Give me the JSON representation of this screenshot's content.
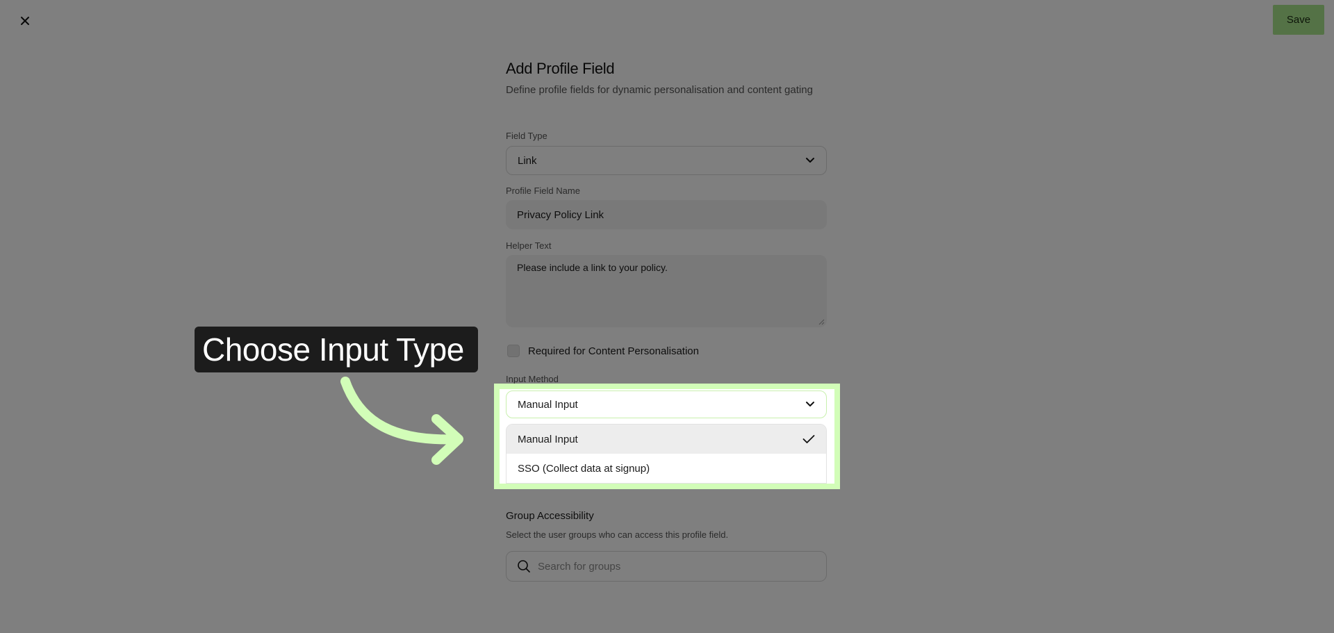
{
  "header": {
    "close_icon": "close-icon",
    "save_label": "Save"
  },
  "form": {
    "title": "Add Profile Field",
    "subtitle": "Define profile fields for dynamic personalisation and content gating",
    "field_type": {
      "label": "Field Type",
      "value": "Link"
    },
    "field_name": {
      "label": "Profile Field Name",
      "value": "Privacy Policy Link"
    },
    "helper_text": {
      "label": "Helper Text",
      "value": "Please include a link to your policy."
    },
    "required": {
      "label": "Required for Content Personalisation",
      "checked": false
    },
    "input_method": {
      "label": "Input Method",
      "value": "Manual Input",
      "options": [
        {
          "label": "Manual Input",
          "selected": true
        },
        {
          "label": "SSO (Collect data at signup)",
          "selected": false
        }
      ]
    },
    "group_accessibility": {
      "title": "Group Accessibility",
      "subtitle": "Select the user groups who can access this profile field.",
      "search_placeholder": "Search for groups"
    }
  },
  "overlay": {
    "callout_text": "Choose Input Type",
    "highlight_color": "#d2fdb8",
    "arrow_color": "#d2fdb8"
  },
  "colors": {
    "accent": "#a9e58d"
  }
}
